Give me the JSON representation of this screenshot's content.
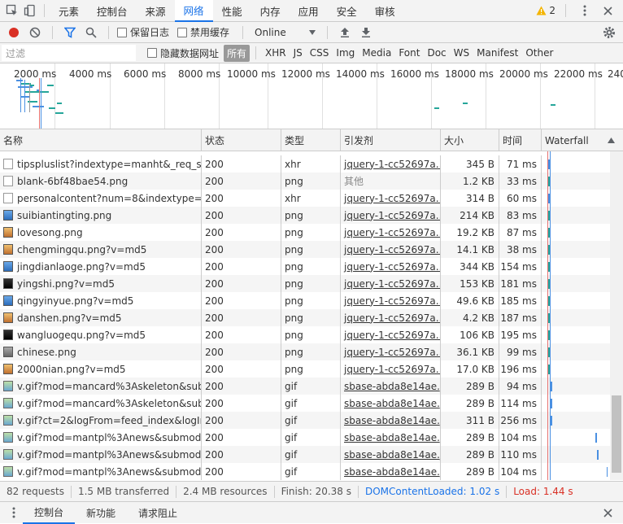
{
  "tabs": [
    {
      "label": "元素",
      "active": false
    },
    {
      "label": "控制台",
      "active": false
    },
    {
      "label": "来源",
      "active": false
    },
    {
      "label": "网络",
      "active": true
    },
    {
      "label": "性能",
      "active": false
    },
    {
      "label": "内存",
      "active": false
    },
    {
      "label": "应用",
      "active": false
    },
    {
      "label": "安全",
      "active": false
    },
    {
      "label": "审核",
      "active": false
    }
  ],
  "warnings": "2",
  "toolbar": {
    "preserve_log": "保留日志",
    "disable_cache": "禁用缓存",
    "throttle": "Online"
  },
  "filter": {
    "placeholder": "过滤",
    "hide_data_urls": "隐藏数据网址",
    "types": [
      "所有",
      "XHR",
      "JS",
      "CSS",
      "Img",
      "Media",
      "Font",
      "Doc",
      "WS",
      "Manifest",
      "Other"
    ]
  },
  "overview": {
    "ticks": [
      "2000 ms",
      "4000 ms",
      "6000 ms",
      "8000 ms",
      "10000 ms",
      "12000 ms",
      "14000 ms",
      "16000 ms",
      "18000 ms",
      "20000 ms",
      "22000 ms",
      "240"
    ]
  },
  "columns": [
    "名称",
    "状态",
    "类型",
    "引发剂",
    "大小",
    "时间",
    "Waterfall"
  ],
  "rows": [
    {
      "name": "tipspluslist?indextype=manht&_req_seq...",
      "status": "200",
      "type": "xhr",
      "initiator": "jquery-1-cc52697a...",
      "size": "345 B",
      "time": "71 ms",
      "icon": "doc",
      "wf": 2
    },
    {
      "name": "blank-6bf48bae54.png",
      "status": "200",
      "type": "png",
      "initiator": "其他",
      "size": "1.2 KB",
      "time": "33 ms",
      "icon": "doc",
      "wf": 1
    },
    {
      "name": "personalcontent?num=8&indextype=m...",
      "status": "200",
      "type": "xhr",
      "initiator": "jquery-1-cc52697a...",
      "size": "314 B",
      "time": "60 ms",
      "icon": "doc",
      "wf": 2
    },
    {
      "name": "suibiantingting.png",
      "status": "200",
      "type": "png",
      "initiator": "jquery-1-cc52697a...",
      "size": "214 KB",
      "time": "83 ms",
      "icon": "img",
      "wf": 2
    },
    {
      "name": "lovesong.png",
      "status": "200",
      "type": "png",
      "initiator": "jquery-1-cc52697a...",
      "size": "19.2 KB",
      "time": "87 ms",
      "icon": "img2",
      "wf": 2
    },
    {
      "name": "chengmingqu.png?v=md5",
      "status": "200",
      "type": "png",
      "initiator": "jquery-1-cc52697a...",
      "size": "14.1 KB",
      "time": "38 ms",
      "icon": "img2",
      "wf": 2
    },
    {
      "name": "jingdianlaoge.png?v=md5",
      "status": "200",
      "type": "png",
      "initiator": "jquery-1-cc52697a...",
      "size": "344 KB",
      "time": "154 ms",
      "icon": "img",
      "wf": 2
    },
    {
      "name": "yingshi.png?v=md5",
      "status": "200",
      "type": "png",
      "initiator": "jquery-1-cc52697a...",
      "size": "153 KB",
      "time": "181 ms",
      "icon": "img3",
      "wf": 2
    },
    {
      "name": "qingyinyue.png?v=md5",
      "status": "200",
      "type": "png",
      "initiator": "jquery-1-cc52697a...",
      "size": "49.6 KB",
      "time": "185 ms",
      "icon": "img",
      "wf": 2
    },
    {
      "name": "danshen.png?v=md5",
      "status": "200",
      "type": "png",
      "initiator": "jquery-1-cc52697a...",
      "size": "4.2 KB",
      "time": "187 ms",
      "icon": "img2",
      "wf": 2
    },
    {
      "name": "wangluogequ.png?v=md5",
      "status": "200",
      "type": "png",
      "initiator": "jquery-1-cc52697a...",
      "size": "106 KB",
      "time": "195 ms",
      "icon": "img3",
      "wf": 2
    },
    {
      "name": "chinese.png",
      "status": "200",
      "type": "png",
      "initiator": "jquery-1-cc52697a...",
      "size": "36.1 KB",
      "time": "99 ms",
      "icon": "img4",
      "wf": 2
    },
    {
      "name": "2000nian.png?v=md5",
      "status": "200",
      "type": "png",
      "initiator": "jquery-1-cc52697a...",
      "size": "17.0 KB",
      "time": "196 ms",
      "icon": "img2",
      "wf": 2
    },
    {
      "name": "v.gif?mod=mancard%3Askeleton&sub...",
      "status": "200",
      "type": "gif",
      "initiator": "sbase-abda8e14ae.j...",
      "size": "289 B",
      "time": "94 ms",
      "icon": "gif",
      "wf": 3
    },
    {
      "name": "v.gif?mod=mancard%3Askeleton&sub...",
      "status": "200",
      "type": "gif",
      "initiator": "sbase-abda8e14ae.j...",
      "size": "289 B",
      "time": "114 ms",
      "icon": "gif",
      "wf": 3
    },
    {
      "name": "v.gif?ct=2&logFrom=feed_index&logIn...",
      "status": "200",
      "type": "gif",
      "initiator": "sbase-abda8e14ae.j...",
      "size": "311 B",
      "time": "256 ms",
      "icon": "gif",
      "wf": 3
    },
    {
      "name": "v.gif?mod=mantpl%3Anews&submod=...",
      "status": "200",
      "type": "gif",
      "initiator": "sbase-abda8e14ae.j...",
      "size": "289 B",
      "time": "104 ms",
      "icon": "gif",
      "wf": 4
    },
    {
      "name": "v.gif?mod=mantpl%3Anews&submod=...",
      "status": "200",
      "type": "gif",
      "initiator": "sbase-abda8e14ae.j...",
      "size": "289 B",
      "time": "110 ms",
      "icon": "gif",
      "wf": 5
    },
    {
      "name": "v.gif?mod=mantpl%3Anews&submod=...",
      "status": "200",
      "type": "gif",
      "initiator": "sbase-abda8e14ae.j...",
      "size": "289 B",
      "time": "104 ms",
      "icon": "gif",
      "wf": 6
    }
  ],
  "status": {
    "requests": "82 requests",
    "transferred": "1.5 MB transferred",
    "resources": "2.4 MB resources",
    "finish": "Finish: 20.38 s",
    "dom": "DOMContentLoaded: 1.02 s",
    "load": "Load: 1.44 s",
    "dom_color": "#1a73e8",
    "load_color": "#d93025"
  },
  "drawer": {
    "tabs": [
      "控制台",
      "新功能",
      "请求阻止"
    ]
  }
}
